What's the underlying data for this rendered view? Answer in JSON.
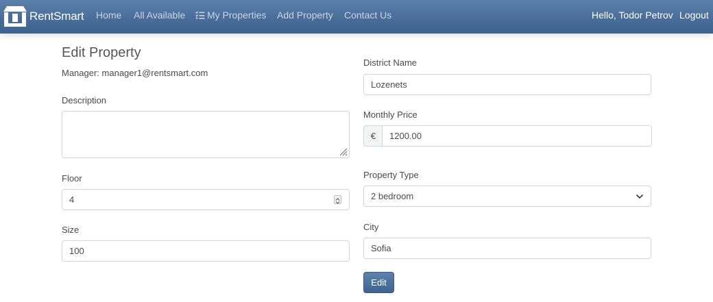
{
  "navbar": {
    "brand": "RentSmart",
    "links": [
      {
        "label": "Home"
      },
      {
        "label": "All Available"
      },
      {
        "label": "My Properties",
        "icon": "list-check-icon"
      },
      {
        "label": "Add Property"
      },
      {
        "label": "Contact Us"
      }
    ],
    "greeting": "Hello, Todor Petrov",
    "logout": "Logout"
  },
  "form": {
    "title": "Edit Property",
    "manager": "Manager: manager1@rentsmart.com",
    "description": {
      "label": "Description",
      "value": ""
    },
    "floor": {
      "label": "Floor",
      "value": "4"
    },
    "size": {
      "label": "Size",
      "value": "100"
    },
    "district": {
      "label": "District Name",
      "value": "Lozenets"
    },
    "price": {
      "label": "Monthly Price",
      "currency": "€",
      "value": "1200.00"
    },
    "property_type": {
      "label": "Property Type",
      "selected": "2 bedroom"
    },
    "city": {
      "label": "City",
      "value": "Sofia"
    },
    "submit_label": "Edit"
  },
  "colors": {
    "navbar": "#4a6e99",
    "nav_link": "#c7d5e6",
    "button": "#4a6e99"
  }
}
